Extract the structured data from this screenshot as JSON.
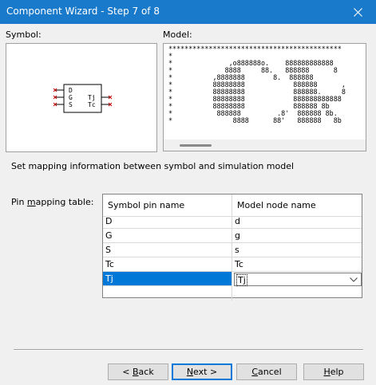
{
  "window": {
    "title": "Component Wizard - Step 7 of 8"
  },
  "symbol": {
    "label": "Symbol:",
    "pins_left": [
      "D",
      "G",
      "S"
    ],
    "pins_right": [
      "Tj",
      "Tc"
    ]
  },
  "model": {
    "label": "Model:",
    "text": "*******************************************\n*\n*              ,o888888o.    888888888888\n*             8888     88.   888888      8\n*          ,8888888       8.  888888      \n*          88888888            888888      ,\n*          88888888            888888.     8\n*          88888888            888888888888\n*          88888888            888888 8b\n*           888888         .8'  888888 8b.\n*               8888      88'   888888   8b"
  },
  "instruction": "Set mapping information between symbol and simulation model",
  "mapping": {
    "label_pre": "Pin ",
    "label_u": "m",
    "label_post": "apping table:",
    "col_symbol": "Symbol pin name",
    "col_model": "Model node name",
    "rows": [
      {
        "symbol": "D",
        "model": "d"
      },
      {
        "symbol": "G",
        "model": "g"
      },
      {
        "symbol": "S",
        "model": "s"
      },
      {
        "symbol": "Tc",
        "model": "Tc"
      },
      {
        "symbol": "Tj",
        "model": "Tj"
      }
    ],
    "selected_index": 4
  },
  "buttons": {
    "back": {
      "prefix": "< ",
      "u": "B",
      "rest": "ack"
    },
    "next": {
      "u": "N",
      "rest": "ext >"
    },
    "cancel": {
      "u": "C",
      "rest": "ancel"
    },
    "help": {
      "u": "H",
      "rest": "elp"
    }
  },
  "colors": {
    "titlebar": "#1979ca",
    "selection": "#0078d7",
    "pin_mark": "#c00000"
  }
}
